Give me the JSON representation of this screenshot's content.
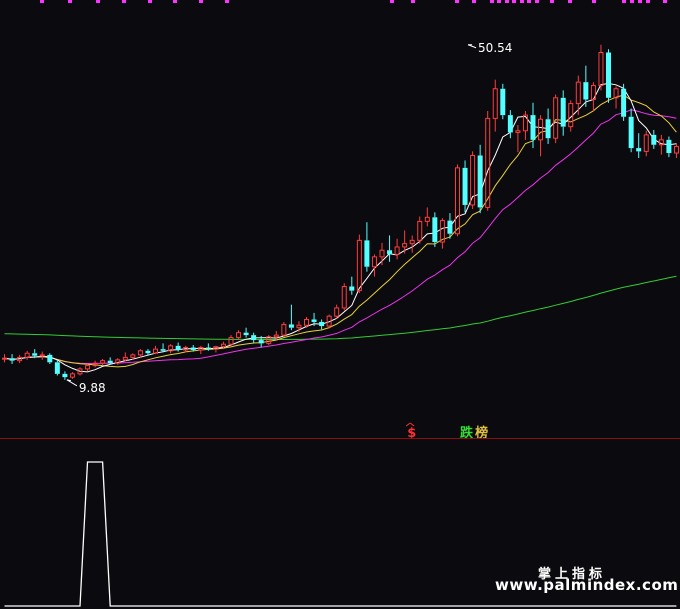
{
  "chart_data": [
    {
      "type": "candlestick",
      "title": "",
      "price_range": [
        5,
        55
      ],
      "annotations": {
        "high_label": "50.54",
        "low_label": "9.88",
        "high_value": 50.54,
        "low_value": 9.88,
        "high_index": 61,
        "low_index": 8
      },
      "signals": [
        {
          "label": "$",
          "color": "#ff3030",
          "index": 54
        },
        {
          "label": "跌",
          "color": "#33dd33",
          "index": 61
        },
        {
          "label": "榜",
          "color": "#e0c040",
          "index": 63
        }
      ],
      "up_color": "#ff3c3c",
      "down_color": "#54ffff",
      "candles": [
        [
          12.5,
          13.0,
          12.0,
          12.5
        ],
        [
          12.5,
          13.0,
          11.8,
          12.2
        ],
        [
          12.2,
          12.9,
          11.9,
          12.6
        ],
        [
          12.6,
          13.4,
          12.3,
          13.1
        ],
        [
          13.1,
          13.6,
          12.5,
          12.8
        ],
        [
          12.8,
          13.3,
          12.3,
          12.9
        ],
        [
          12.9,
          13.1,
          11.8,
          12.0
        ],
        [
          12.0,
          12.3,
          10.4,
          10.6
        ],
        [
          10.6,
          10.9,
          9.88,
          10.2
        ],
        [
          10.2,
          10.8,
          10.0,
          10.6
        ],
        [
          10.6,
          11.4,
          10.4,
          11.2
        ],
        [
          11.2,
          11.8,
          10.9,
          11.6
        ],
        [
          11.6,
          12.2,
          11.4,
          11.9
        ],
        [
          11.9,
          12.4,
          11.6,
          12.2
        ],
        [
          12.2,
          12.6,
          11.8,
          11.9
        ],
        [
          11.9,
          12.5,
          11.7,
          12.3
        ],
        [
          12.3,
          13.2,
          12.1,
          12.6
        ],
        [
          12.6,
          13.1,
          12.3,
          12.9
        ],
        [
          12.9,
          13.6,
          12.6,
          13.4
        ],
        [
          13.4,
          13.6,
          12.8,
          13.1
        ],
        [
          13.1,
          14.0,
          13.0,
          13.6
        ],
        [
          13.6,
          14.3,
          13.2,
          13.4
        ],
        [
          13.4,
          14.2,
          13.1,
          14.0
        ],
        [
          14.0,
          14.4,
          13.3,
          13.5
        ],
        [
          13.5,
          14.0,
          13.2,
          13.8
        ],
        [
          13.8,
          14.1,
          13.3,
          13.5
        ],
        [
          13.5,
          14.0,
          13.0,
          13.8
        ],
        [
          13.8,
          14.3,
          13.4,
          13.6
        ],
        [
          13.6,
          14.0,
          13.2,
          13.9
        ],
        [
          13.9,
          14.5,
          13.6,
          14.2
        ],
        [
          14.2,
          15.3,
          14.0,
          15.0
        ],
        [
          15.0,
          15.9,
          14.7,
          15.6
        ],
        [
          15.6,
          16.2,
          15.0,
          15.3
        ],
        [
          15.3,
          15.6,
          14.3,
          14.7
        ],
        [
          14.7,
          15.2,
          13.8,
          14.3
        ],
        [
          14.3,
          15.3,
          14.1,
          15.1
        ],
        [
          15.1,
          15.8,
          14.6,
          15.3
        ],
        [
          15.3,
          16.9,
          15.1,
          16.6
        ],
        [
          16.6,
          19.0,
          15.9,
          16.2
        ],
        [
          16.2,
          17.0,
          15.7,
          16.5
        ],
        [
          16.5,
          17.5,
          16.2,
          17.2
        ],
        [
          17.2,
          18.0,
          16.4,
          16.9
        ],
        [
          16.9,
          17.2,
          16.0,
          16.4
        ],
        [
          16.4,
          17.8,
          16.1,
          17.6
        ],
        [
          17.6,
          19.0,
          17.3,
          18.6
        ],
        [
          18.6,
          21.6,
          18.3,
          21.2
        ],
        [
          21.2,
          22.4,
          20.2,
          20.7
        ],
        [
          20.7,
          27.5,
          20.4,
          26.8
        ],
        [
          26.8,
          29.0,
          23.0,
          23.6
        ],
        [
          23.6,
          25.1,
          22.4,
          24.8
        ],
        [
          24.8,
          26.5,
          23.8,
          25.6
        ],
        [
          25.6,
          27.4,
          24.2,
          25.1
        ],
        [
          25.1,
          27.0,
          24.5,
          26.0
        ],
        [
          26.0,
          28.0,
          25.2,
          26.4
        ],
        [
          26.4,
          27.4,
          25.3,
          26.8
        ],
        [
          26.8,
          29.7,
          26.4,
          29.1
        ],
        [
          29.1,
          30.8,
          28.5,
          29.6
        ],
        [
          29.6,
          30.2,
          26.0,
          26.6
        ],
        [
          26.6,
          29.5,
          25.8,
          29.2
        ],
        [
          29.2,
          30.1,
          27.0,
          27.6
        ],
        [
          27.6,
          36.0,
          27.3,
          35.6
        ],
        [
          35.6,
          36.5,
          30.2,
          31.1
        ],
        [
          31.1,
          37.6,
          30.6,
          37.1
        ],
        [
          37.1,
          38.4,
          30.1,
          30.8
        ],
        [
          30.8,
          42.5,
          30.4,
          41.6
        ],
        [
          41.6,
          46.3,
          40.0,
          45.2
        ],
        [
          45.2,
          45.8,
          41.5,
          42.0
        ],
        [
          42.0,
          42.6,
          39.2,
          39.9
        ],
        [
          39.9,
          40.8,
          37.5,
          40.1
        ],
        [
          40.1,
          42.5,
          39.0,
          42.0
        ],
        [
          42.0,
          43.5,
          38.0,
          39.0
        ],
        [
          39.0,
          42.0,
          37.0,
          41.5
        ],
        [
          41.5,
          42.8,
          38.5,
          39.2
        ],
        [
          39.2,
          44.5,
          38.6,
          44.1
        ],
        [
          44.1,
          45.0,
          39.5,
          40.6
        ],
        [
          40.6,
          43.8,
          40.0,
          43.4
        ],
        [
          43.4,
          46.8,
          42.0,
          46.0
        ],
        [
          46.0,
          48.0,
          43.0,
          43.9
        ],
        [
          43.9,
          46.0,
          42.5,
          45.6
        ],
        [
          45.6,
          50.54,
          45.0,
          49.6
        ],
        [
          49.6,
          50.0,
          43.5,
          44.1
        ],
        [
          44.1,
          45.5,
          42.8,
          45.2
        ],
        [
          45.2,
          45.8,
          41.3,
          41.8
        ],
        [
          41.8,
          42.8,
          37.5,
          38.0
        ],
        [
          38.0,
          39.8,
          36.8,
          37.6
        ],
        [
          37.6,
          40.1,
          37.0,
          39.6
        ],
        [
          39.6,
          40.2,
          37.9,
          38.4
        ],
        [
          38.4,
          39.6,
          37.2,
          39.0
        ],
        [
          39.0,
          39.4,
          36.9,
          37.4
        ],
        [
          37.4,
          38.6,
          36.8,
          38.2
        ]
      ]
    },
    {
      "type": "line",
      "title": "",
      "values": [
        0,
        0,
        0,
        0,
        0,
        0,
        0,
        0,
        0,
        0,
        0,
        1,
        1,
        1,
        0,
        0,
        0,
        0,
        0,
        0,
        0,
        0,
        0,
        0,
        0,
        0,
        0,
        0,
        0,
        0,
        0,
        0,
        0,
        0,
        0,
        0,
        0,
        0,
        0,
        0,
        0,
        0,
        0,
        0,
        0,
        0,
        0,
        0,
        0,
        0,
        0,
        0,
        0,
        0,
        0,
        0,
        0,
        0,
        0,
        0,
        0,
        0,
        0,
        0,
        0,
        0,
        0,
        0,
        0,
        0,
        0,
        0,
        0,
        0,
        0,
        0,
        0,
        0,
        0,
        0,
        0,
        0,
        0,
        0,
        0,
        0,
        0,
        0,
        0,
        0
      ],
      "ylim": [
        0,
        1
      ],
      "color": "#ffffff"
    }
  ],
  "marker_colors": {
    "top_ticks": "#ff33ff",
    "panel_divider": "#8a1010",
    "ma_short": "#ffffff",
    "ma_mid": "#e8d03a",
    "ma_long": "#ee33ee",
    "ma_very_long": "#33cc33"
  },
  "watermark": {
    "cn": "掌上指标",
    "url": "www.palmindex.com"
  }
}
